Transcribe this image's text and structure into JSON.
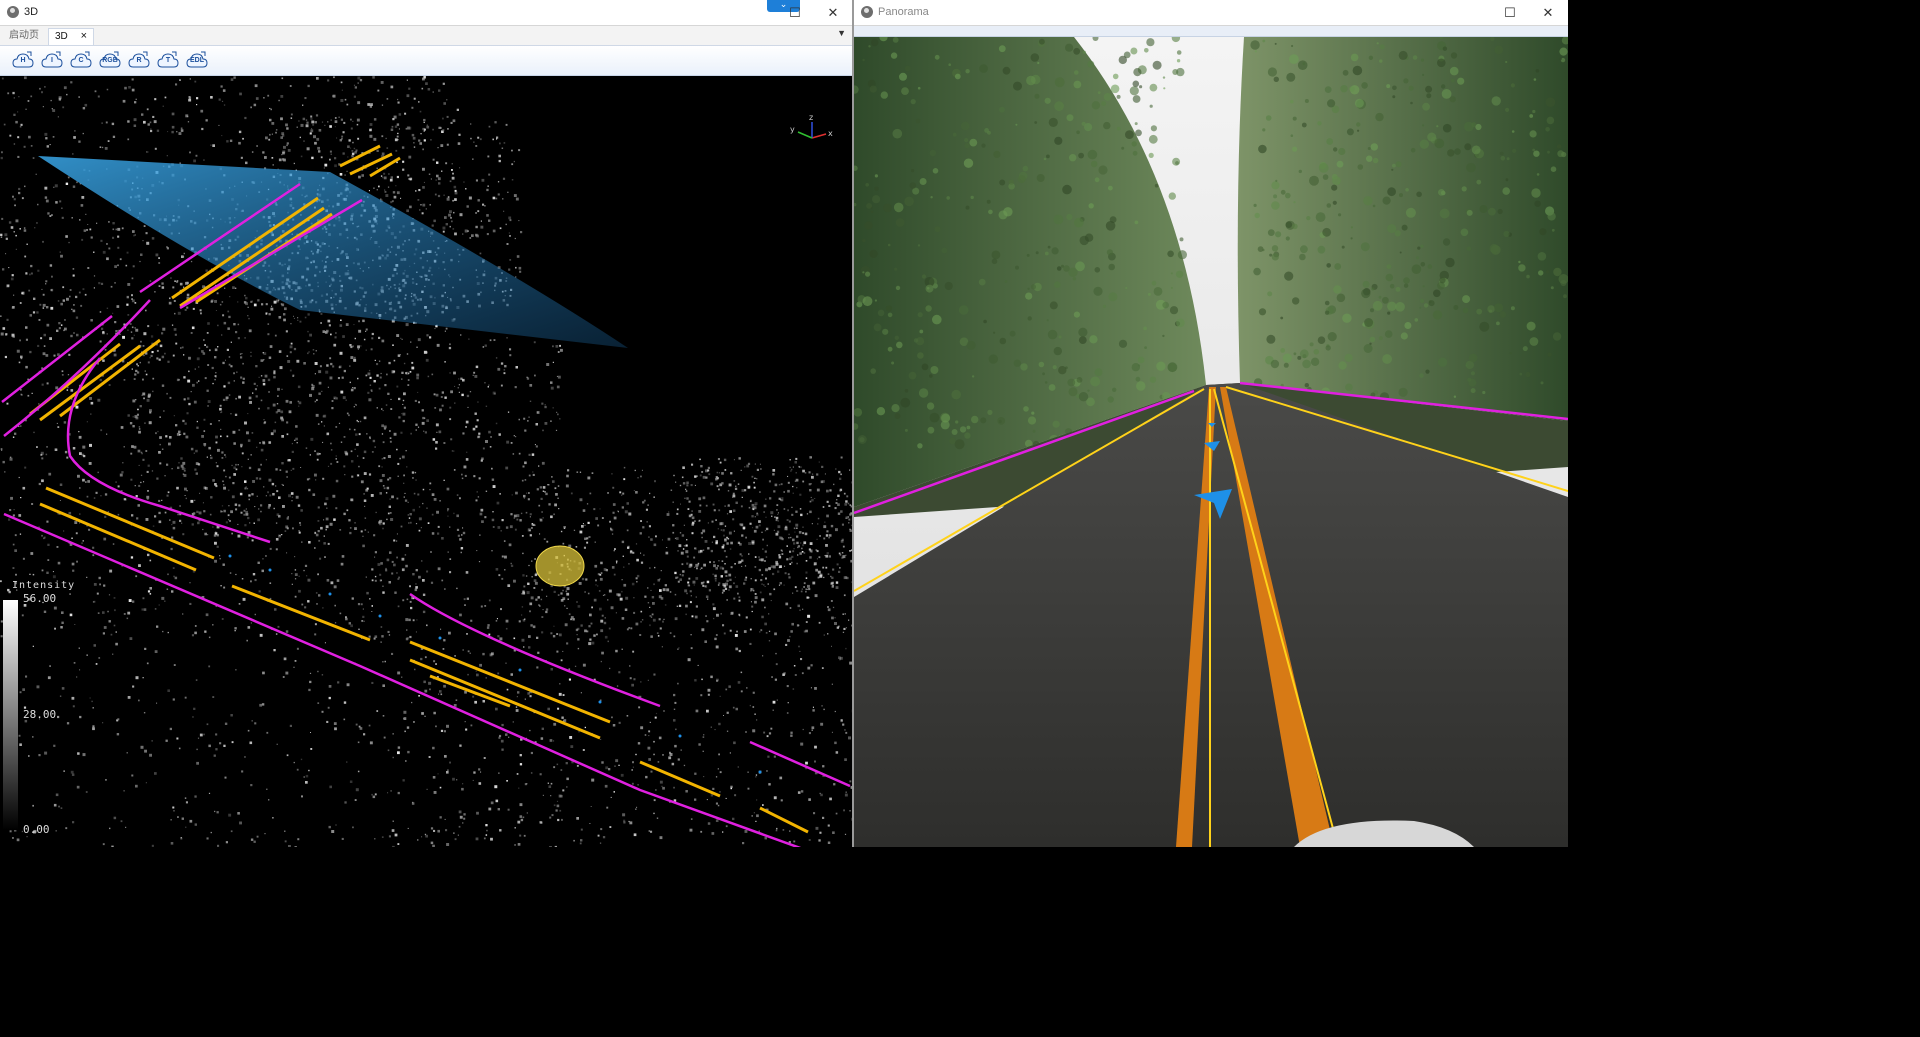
{
  "window_3d": {
    "title": "3D",
    "tabs": [
      {
        "label": "启动页",
        "active": false
      },
      {
        "label": "3D",
        "active": true
      }
    ],
    "tab_close_glyph": "×",
    "overflow_glyph": "▼",
    "minimize_glyph": "—",
    "maximize_glyph": "☐",
    "close_glyph": "✕",
    "dropdown_glyph": "⌄",
    "toolbar": [
      {
        "label": "H",
        "icon": "cloud-h-icon"
      },
      {
        "label": "I",
        "icon": "cloud-i-icon"
      },
      {
        "label": "C",
        "icon": "cloud-c-icon"
      },
      {
        "label": "RGB",
        "icon": "cloud-rgb-icon"
      },
      {
        "label": "R",
        "icon": "cloud-r-icon"
      },
      {
        "label": "T",
        "icon": "cloud-t-icon"
      },
      {
        "label": "EDL",
        "icon": "cloud-edl-icon"
      }
    ],
    "legend": {
      "title": "Intensity",
      "max": "56.00",
      "mid": "28.00",
      "min": "0.00"
    },
    "axis_labels": {
      "x": "x",
      "y": "y",
      "z": "z"
    }
  },
  "window_pano": {
    "title": "Panorama",
    "maximize_glyph": "☐",
    "close_glyph": "✕"
  },
  "colors": {
    "lane_yellow": "#f2b400",
    "boundary_magenta": "#e020e0",
    "marker_blue": "#1e90e8",
    "frustum_blue": "#2a8fd0"
  }
}
